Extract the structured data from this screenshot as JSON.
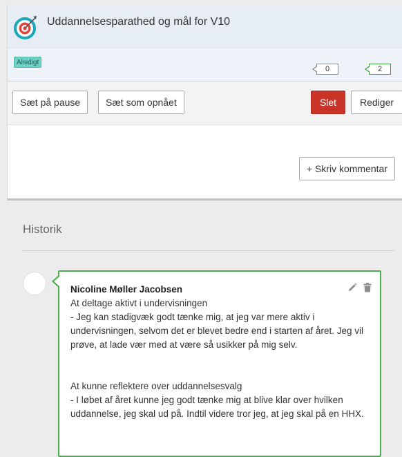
{
  "goal": {
    "title": "Uddannelsesparathed og mål for V10",
    "icon": "target-icon",
    "tag": "Alsidigt",
    "counts": [
      "0",
      "2"
    ]
  },
  "toolbar": {
    "pause_label": "Sæt på pause",
    "achieved_label": "Sæt som opnået",
    "delete_label": "Slet",
    "edit_label": "Rediger"
  },
  "comment": {
    "write_label": "+ Skriv kommentar"
  },
  "history": {
    "title": "Historik",
    "entries": [
      {
        "author": "Nicoline Møller Jacobsen",
        "text": "At deltage aktivt i undervisningen\n- Jeg kan stadigvæk godt tænke mig, at jeg var mere aktiv i undervisningen, selvom det er blevet bedre end i starten af året. Jeg vil prøve, at lade vær med at være så usikker på mig selv.\n\n\nAt kunne reflektere over uddannelsesvalg\n- I løbet af året kunne jeg godt tænke mig at blive klar over hvilken uddannelse, jeg skal ud på. Indtil videre tror jeg, at jeg skal på en HHX."
      }
    ]
  },
  "colors": {
    "header_bg": "#e7edf5",
    "tag_bg": "#6ed2c6",
    "delete_bg": "#c93328",
    "entry_border": "#47b04b"
  }
}
